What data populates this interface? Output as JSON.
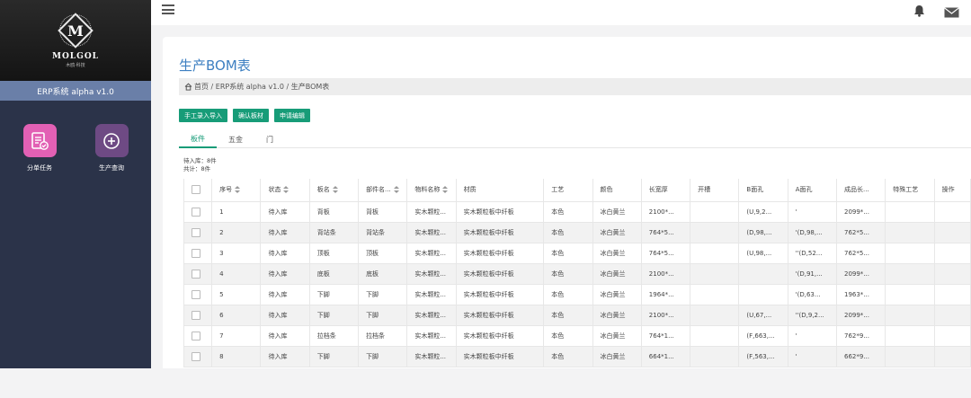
{
  "brand": {
    "letter": "M",
    "name": "MOLGOL",
    "tagline": "木鸥·科技"
  },
  "sidebar": {
    "version": "ERP系统 alpha v1.0",
    "apps": [
      {
        "label": "分单任务",
        "icon": "task-doc-icon"
      },
      {
        "label": "生产查询",
        "icon": "plus-circle-icon"
      }
    ]
  },
  "page": {
    "title": "生产BOM表",
    "breadcrumb": "首页 / ERP系统 alpha v1.0 / 生产BOM表"
  },
  "toolbar": {
    "buttons": [
      "手工录入导入",
      "确认板材",
      "申请编辑"
    ]
  },
  "tabs": [
    "板件",
    "五金",
    "门"
  ],
  "counts": {
    "pending": "待入库：8件",
    "total": "共计：8件"
  },
  "table": {
    "columns": [
      "序号",
      "状态",
      "板名",
      "部件名...",
      "物料名称",
      "材质",
      "工艺",
      "颜色",
      "长宽厚",
      "开槽",
      "B面孔",
      "A面孔",
      "成品长...",
      "特殊工艺",
      "操作"
    ],
    "sortable": [
      true,
      true,
      true,
      true,
      true,
      false,
      false,
      false,
      false,
      false,
      false,
      false,
      false,
      false,
      false
    ],
    "rows": [
      [
        "1",
        "待入库",
        "背板",
        "背板",
        "实木颗粒...",
        "实木颗粒板中纤板",
        "本色",
        "冰白黄兰",
        "2100*...",
        "",
        "(U,9,2...",
        "'",
        "2099*...",
        "",
        ""
      ],
      [
        "2",
        "待入库",
        "背站条",
        "背站条",
        "实木颗粒...",
        "实木颗粒板中纤板",
        "本色",
        "冰白黄兰",
        "764*5...",
        "",
        "(D,98,...",
        "'(D,98,...",
        "762*5...",
        "",
        ""
      ],
      [
        "3",
        "待入库",
        "顶板",
        "顶板",
        "实木颗粒...",
        "实木颗粒板中纤板",
        "本色",
        "冰白黄兰",
        "764*5...",
        "",
        "(U,98,...",
        "''(D,52...",
        "762*5...",
        "",
        ""
      ],
      [
        "4",
        "待入库",
        "底板",
        "底板",
        "实木颗粒...",
        "实木颗粒板中纤板",
        "本色",
        "冰白黄兰",
        "2100*...",
        "",
        "",
        "'(D,91,...",
        "2099*...",
        "",
        ""
      ],
      [
        "5",
        "待入库",
        "下脚",
        "下脚",
        "实木颗粒...",
        "实木颗粒板中纤板",
        "本色",
        "冰白黄兰",
        "1964*...",
        "",
        "",
        "'(D,63...",
        "1963*...",
        "",
        ""
      ],
      [
        "6",
        "待入库",
        "下脚",
        "下脚",
        "实木颗粒...",
        "实木颗粒板中纤板",
        "本色",
        "冰白黄兰",
        "2100*...",
        "",
        "(U,67,...",
        "''(D,9,2...",
        "2099*...",
        "",
        ""
      ],
      [
        "7",
        "待入库",
        "拉档条",
        "拉档条",
        "实木颗粒...",
        "实木颗粒板中纤板",
        "本色",
        "冰白黄兰",
        "764*1...",
        "",
        "(F,663,...",
        "'",
        "762*9...",
        "",
        ""
      ],
      [
        "8",
        "待入库",
        "下脚",
        "下脚",
        "实木颗粒...",
        "实木颗粒板中纤板",
        "本色",
        "冰白黄兰",
        "664*1...",
        "",
        "(F,563,...",
        "'",
        "662*9...",
        "",
        ""
      ]
    ]
  },
  "colors": {
    "accent": "#179c78",
    "title": "#3d7fc1",
    "sidebar": "#2b3349",
    "version_bar": "#6a7fa8"
  }
}
